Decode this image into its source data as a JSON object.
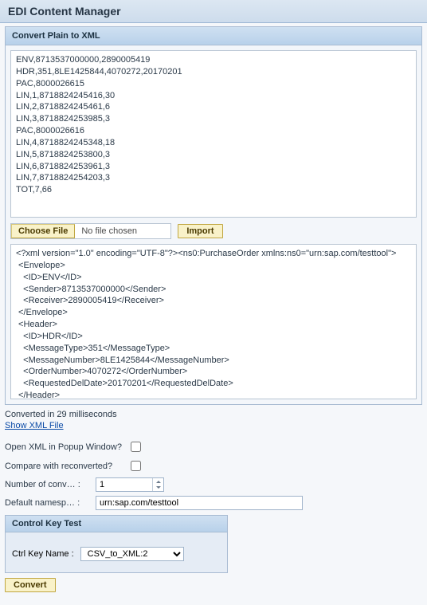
{
  "app_title": "EDI Content Manager",
  "panel": {
    "title": "Convert Plain to XML"
  },
  "input_text": "ENV,8713537000000,2890005419\nHDR,351,8LE1425844,4070272,20170201\nPAC,8000026615\nLIN,1,8718824245416,30\nLIN,2,8718824245461,6\nLIN,3,8718824253985,3\nPAC,8000026616\nLIN,4,8718824245348,18\nLIN,5,8718824253800,3\nLIN,6,8718824253961,3\nLIN,7,8718824254203,3\nTOT,7,66",
  "file": {
    "choose_label": "Choose File",
    "status": "No file chosen",
    "import_label": "Import"
  },
  "xml_output": "<?xml version=\"1.0\" encoding=\"UTF-8\"?><ns0:PurchaseOrder xmlns:ns0=\"urn:sap.com/testtool\">\n <Envelope>\n   <ID>ENV</ID>\n   <Sender>8713537000000</Sender>\n   <Receiver>2890005419</Receiver>\n </Envelope>\n <Header>\n   <ID>HDR</ID>\n   <MessageType>351</MessageType>\n   <MessageNumber>8LE1425844</MessageNumber>\n   <OrderNumber>4070272</OrderNumber>\n   <RequestedDelDate>20170201</RequestedDelDate>\n </Header>\n <Carton>\n   <ID>PAC</ID>",
  "status_text": "Converted in 29 milliseconds",
  "link_show_xml": "Show XML File",
  "options": {
    "popup_label": "Open XML in Popup Window?",
    "popup_checked": false,
    "compare_label": "Compare with reconverted?",
    "compare_checked": false,
    "numconv_label": "Number of conv… :",
    "numconv_value": "1",
    "namespace_label": "Default namesp… :",
    "namespace_value": "urn:sap.com/testtool"
  },
  "control_key": {
    "title": "Control Key Test",
    "label": "Ctrl Key Name :",
    "selected": "CSV_to_XML:2"
  },
  "convert_label": "Convert"
}
